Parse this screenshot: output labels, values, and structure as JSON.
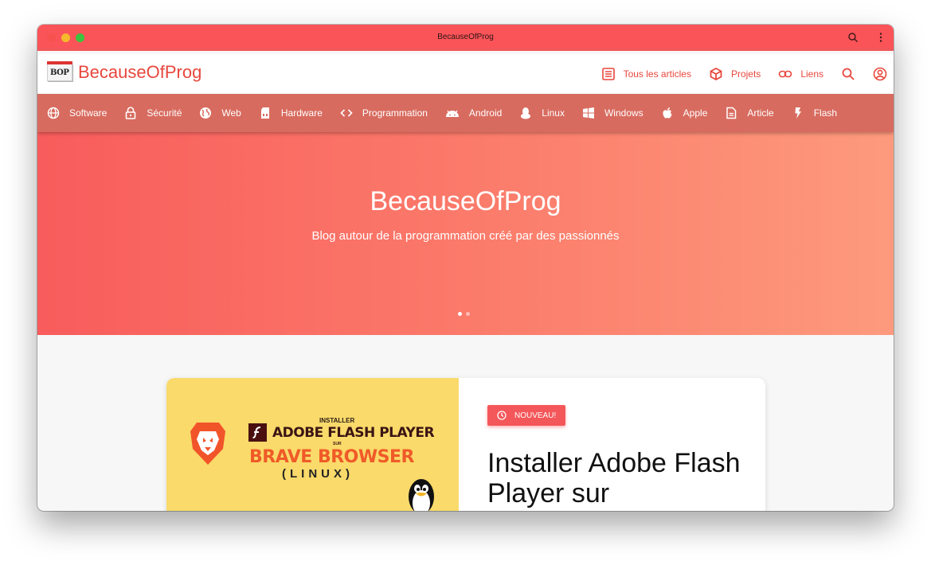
{
  "window": {
    "title": "BecauseOfProg"
  },
  "appbar": {
    "logo_text": "BOP",
    "brand": "BecauseOfProg",
    "nav": [
      {
        "label": "Tous les articles",
        "icon": "newspaper-icon"
      },
      {
        "label": "Projets",
        "icon": "cube-icon"
      },
      {
        "label": "Liens",
        "icon": "link-icon"
      }
    ],
    "search_icon": "search-icon",
    "account_icon": "account-circle-icon"
  },
  "categories": [
    {
      "label": "Software",
      "icon": "globe-grid-icon"
    },
    {
      "label": "Sécurité",
      "icon": "lock-icon"
    },
    {
      "label": "Web",
      "icon": "earth-icon"
    },
    {
      "label": "Hardware",
      "icon": "sd-card-icon"
    },
    {
      "label": "Programmation",
      "icon": "code-brackets-icon"
    },
    {
      "label": "Android",
      "icon": "android-icon"
    },
    {
      "label": "Linux",
      "icon": "tux-icon"
    },
    {
      "label": "Windows",
      "icon": "windows-icon"
    },
    {
      "label": "Apple",
      "icon": "apple-icon"
    },
    {
      "label": "Article",
      "icon": "document-icon"
    },
    {
      "label": "Flash",
      "icon": "lightning-icon"
    }
  ],
  "hero": {
    "title": "BecauseOfProg",
    "subtitle": "Blog autour de la programmation créé par des passionnés",
    "slides_total": 2,
    "slide_active": 1
  },
  "featured": {
    "image_text": {
      "small": "INSTALLER",
      "product": "ADOBE FLASH PLAYER",
      "sur": "SUR",
      "browser": "BRAVE BROWSER",
      "platform": "(LINUX)"
    },
    "badge": "NOUVEAU!",
    "title": "Installer Adobe Flash Player sur"
  },
  "colors": {
    "titlebar": "#fb5458",
    "brand": "#e8473c",
    "catbar": "#d86b5f",
    "hero_start": "#f85c5c",
    "hero_end": "#fd9a7d",
    "badge": "#f4575a",
    "image_bg": "#f9da6a"
  }
}
